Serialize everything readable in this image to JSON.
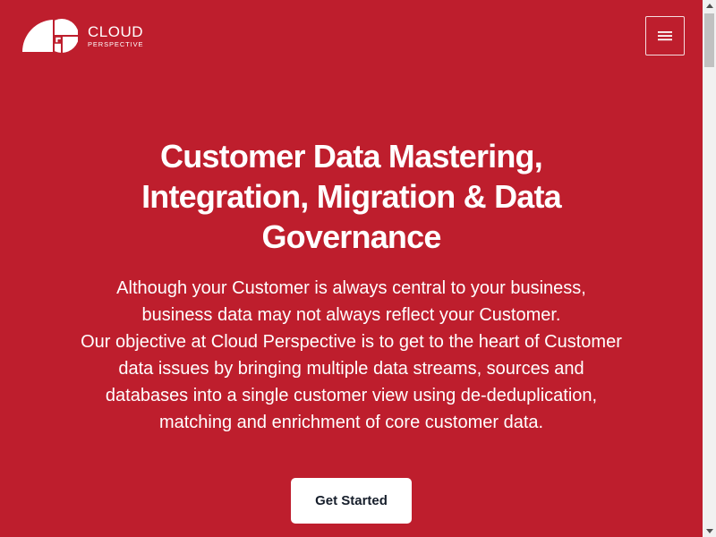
{
  "colors": {
    "brand_red": "#be1e2d",
    "text_light": "#ffffff",
    "button_bg": "#ffffff",
    "button_text": "#161e2b"
  },
  "header": {
    "logo_name": "CLOUD",
    "logo_tagline": "PERSPECTIVE",
    "logo_icon": "cloud-perspective-logo-icon",
    "menu_icon": "hamburger-menu-icon"
  },
  "hero": {
    "title": "Customer Data Mastering, Integration, Migration & Data Governance",
    "paragraph_1": "Although your Customer is always central to your business, business data may not always reflect your Customer.",
    "paragraph_2": "Our objective at Cloud Perspective is to get to the heart of Customer data issues by bringing multiple data streams, sources and databases into a single customer view using de-deduplication, matching and enrichment of core customer data.",
    "cta_label": "Get Started"
  }
}
